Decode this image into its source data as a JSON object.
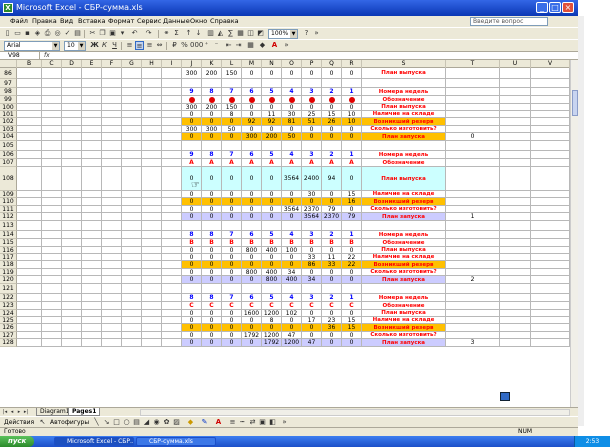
{
  "window": {
    "title": "Microsoft Excel - СБР-сумма.xls",
    "help_placeholder": "Введите вопрос"
  },
  "menu": [
    "Файл",
    "Правка",
    "Вид",
    "Вставка",
    "Формат",
    "Сервис",
    "Данные",
    "Окно",
    "Справка"
  ],
  "toolbar": {
    "zoom": "100%",
    "font_name": "Arial",
    "font_size": "10"
  },
  "formula": {
    "namebox": "V98",
    "fx": "fx"
  },
  "columns": [
    "B",
    "C",
    "D",
    "E",
    "F",
    "G",
    "H",
    "I",
    "J",
    "K",
    "L",
    "M",
    "N",
    "O",
    "P",
    "Q",
    "R",
    "S",
    "T",
    "U",
    "V"
  ],
  "rows": [
    {
      "num": "86",
      "h": 11,
      "style": "",
      "cells": {
        "J": "300",
        "K": "200",
        "L": "150",
        "M": "0",
        "N": "0",
        "O": "0",
        "P": "0",
        "Q": "0",
        "R": "0",
        "S": "План выпуска"
      },
      "color": "red"
    },
    {
      "num": "97",
      "h": 9,
      "style": "",
      "cells": {},
      "color": ""
    },
    {
      "num": "98",
      "h": 8,
      "style": "",
      "cells": {
        "J": "9",
        "K": "8",
        "L": "7",
        "M": "6",
        "N": "5",
        "O": "4",
        "P": "3",
        "Q": "2",
        "R": "1",
        "S": "Номера недель"
      },
      "color": "blue"
    },
    {
      "num": "99",
      "h": 8,
      "style": "",
      "cells": {
        "S": "Обозначение"
      },
      "dots": true,
      "color": "red"
    },
    {
      "num": "100",
      "h": 7,
      "style": "",
      "cells": {
        "J": "300",
        "K": "200",
        "L": "150",
        "M": "0",
        "N": "0",
        "O": "0",
        "P": "0",
        "Q": "0",
        "R": "0",
        "S": "План выпуска"
      },
      "color": "red"
    },
    {
      "num": "101",
      "h": 7,
      "style": "",
      "cells": {
        "J": "0",
        "K": "0",
        "L": "8",
        "M": "0",
        "N": "11",
        "O": "30",
        "P": "25",
        "Q": "15",
        "R": "10",
        "S": "Наличие на складе"
      },
      "color": "red"
    },
    {
      "num": "102",
      "h": 8,
      "style": "orange",
      "cells": {
        "J": "0",
        "K": "0",
        "L": "0",
        "M": "92",
        "N": "92",
        "O": "81",
        "P": "51",
        "Q": "26",
        "R": "10",
        "S": "Возникший резерв"
      },
      "color": "red"
    },
    {
      "num": "103",
      "h": 7,
      "style": "",
      "cells": {
        "J": "300",
        "K": "300",
        "L": "50",
        "M": "0",
        "N": "0",
        "O": "0",
        "P": "0",
        "Q": "0",
        "R": "0",
        "S": "Сколько изготовить?"
      },
      "color": "red"
    },
    {
      "num": "104",
      "h": 8,
      "style": "orange",
      "cells": {
        "J": "0",
        "K": "0",
        "L": "0",
        "M": "300",
        "N": "200",
        "O": "50",
        "P": "0",
        "Q": "0",
        "R": "0",
        "S": "План запуска",
        "T": "0"
      },
      "color": "red"
    },
    {
      "num": "105",
      "h": 10,
      "style": "",
      "cells": {},
      "color": ""
    },
    {
      "num": "106",
      "h": 8,
      "style": "",
      "cells": {
        "J": "9",
        "K": "8",
        "L": "7",
        "M": "6",
        "N": "5",
        "O": "4",
        "P": "3",
        "Q": "2",
        "R": "1",
        "S": "Номера недель"
      },
      "color": "blue"
    },
    {
      "num": "107",
      "h": 8,
      "style": "",
      "cells": {
        "J": "А",
        "K": "А",
        "L": "А",
        "M": "А",
        "N": "А",
        "O": "А",
        "P": "А",
        "Q": "А",
        "R": "А",
        "S": "Обозначение"
      },
      "color": "red"
    },
    {
      "num": "108",
      "h": 24,
      "style": "cyan",
      "cells": {
        "J": "0",
        "K": "0",
        "L": "0",
        "M": "0",
        "N": "0",
        "O": "3564",
        "P": "2400",
        "Q": "94",
        "R": "0",
        "S": "План выпуска"
      },
      "color": "red"
    },
    {
      "num": "109",
      "h": 7,
      "style": "",
      "cells": {
        "J": "0",
        "K": "0",
        "L": "0",
        "M": "0",
        "N": "0",
        "O": "0",
        "P": "30",
        "Q": "0",
        "R": "15",
        "S": "Наличие на складе"
      },
      "color": "red"
    },
    {
      "num": "110",
      "h": 8,
      "style": "orange",
      "cells": {
        "J": "0",
        "K": "0",
        "L": "0",
        "M": "0",
        "N": "0",
        "O": "0",
        "P": "0",
        "Q": "0",
        "R": "16",
        "S": "Возникший резерв"
      },
      "color": "red"
    },
    {
      "num": "111",
      "h": 7,
      "style": "",
      "cells": {
        "J": "0",
        "K": "0",
        "L": "0",
        "M": "0",
        "N": "0",
        "O": "3564",
        "P": "2370",
        "Q": "79",
        "R": "0",
        "S": "Сколько изготовить?"
      },
      "color": "red"
    },
    {
      "num": "112",
      "h": 8,
      "style": "lilac",
      "cells": {
        "J": "0",
        "K": "0",
        "L": "0",
        "M": "0",
        "N": "0",
        "O": "0",
        "P": "3564",
        "Q": "2370",
        "R": "79",
        "S": "План запуска",
        "T": "1"
      },
      "color": "red"
    },
    {
      "num": "113",
      "h": 10,
      "style": "",
      "cells": {},
      "color": ""
    },
    {
      "num": "114",
      "h": 8,
      "style": "",
      "cells": {
        "J": "8",
        "K": "8",
        "L": "7",
        "M": "6",
        "N": "5",
        "O": "4",
        "P": "3",
        "Q": "2",
        "R": "1",
        "S": "Номера недель"
      },
      "color": "blue"
    },
    {
      "num": "115",
      "h": 8,
      "style": "",
      "cells": {
        "J": "В",
        "K": "В",
        "L": "В",
        "M": "В",
        "N": "В",
        "O": "В",
        "P": "В",
        "Q": "В",
        "R": "В",
        "S": "Обозначение"
      },
      "color": "red"
    },
    {
      "num": "116",
      "h": 7,
      "style": "",
      "cells": {
        "J": "0",
        "K": "0",
        "L": "0",
        "M": "800",
        "N": "400",
        "O": "100",
        "P": "0",
        "Q": "0",
        "R": "0",
        "S": "План выпуска"
      },
      "color": "red"
    },
    {
      "num": "117",
      "h": 7,
      "style": "",
      "cells": {
        "J": "0",
        "K": "0",
        "L": "0",
        "M": "0",
        "N": "0",
        "O": "0",
        "P": "33",
        "Q": "11",
        "R": "22",
        "S": "Наличие на складе"
      },
      "color": "red"
    },
    {
      "num": "118",
      "h": 8,
      "style": "orange",
      "cells": {
        "J": "0",
        "K": "0",
        "L": "0",
        "M": "0",
        "N": "0",
        "O": "0",
        "P": "86",
        "Q": "33",
        "R": "22",
        "S": "Возникший резерв"
      },
      "color": "red"
    },
    {
      "num": "119",
      "h": 7,
      "style": "",
      "cells": {
        "J": "0",
        "K": "0",
        "L": "0",
        "M": "800",
        "N": "400",
        "O": "34",
        "P": "0",
        "Q": "0",
        "R": "0",
        "S": "Сколько изготовить?"
      },
      "color": "red"
    },
    {
      "num": "120",
      "h": 8,
      "style": "lilac",
      "cells": {
        "J": "0",
        "K": "0",
        "L": "0",
        "M": "0",
        "N": "800",
        "O": "400",
        "P": "34",
        "Q": "0",
        "R": "0",
        "S": "План запуска",
        "T": "2"
      },
      "color": "red"
    },
    {
      "num": "121",
      "h": 10,
      "style": "",
      "cells": {},
      "color": ""
    },
    {
      "num": "122",
      "h": 8,
      "style": "",
      "cells": {
        "J": "8",
        "K": "8",
        "L": "7",
        "M": "6",
        "N": "5",
        "O": "4",
        "P": "3",
        "Q": "2",
        "R": "1",
        "S": "Номера недель"
      },
      "color": "blue"
    },
    {
      "num": "123",
      "h": 8,
      "style": "",
      "cells": {
        "J": "С",
        "K": "С",
        "L": "С",
        "M": "С",
        "N": "С",
        "O": "С",
        "P": "С",
        "Q": "С",
        "R": "С",
        "S": "Обозначение"
      },
      "color": "red"
    },
    {
      "num": "124",
      "h": 7,
      "style": "",
      "cells": {
        "J": "0",
        "K": "0",
        "L": "0",
        "M": "1600",
        "N": "1200",
        "O": "102",
        "P": "0",
        "Q": "0",
        "R": "0",
        "S": "План выпуска"
      },
      "color": "red"
    },
    {
      "num": "125",
      "h": 7,
      "style": "",
      "cells": {
        "J": "0",
        "K": "0",
        "L": "0",
        "M": "0",
        "N": "8",
        "O": "0",
        "P": "17",
        "Q": "23",
        "R": "15",
        "S": "Наличие на складе"
      },
      "color": "red"
    },
    {
      "num": "126",
      "h": 8,
      "style": "orange",
      "cells": {
        "J": "0",
        "K": "0",
        "L": "0",
        "M": "0",
        "N": "0",
        "O": "0",
        "P": "0",
        "Q": "36",
        "R": "15",
        "S": "Возникший резерв"
      },
      "color": "red"
    },
    {
      "num": "127",
      "h": 7,
      "style": "",
      "cells": {
        "J": "0",
        "K": "0",
        "L": "0",
        "M": "1792",
        "N": "1200",
        "O": "47",
        "P": "0",
        "Q": "0",
        "R": "0",
        "S": "Сколько изготовить?"
      },
      "color": "red"
    },
    {
      "num": "128",
      "h": 8,
      "style": "lilac",
      "cells": {
        "J": "0",
        "K": "0",
        "L": "0",
        "M": "0",
        "N": "1792",
        "O": "1200",
        "P": "47",
        "Q": "0",
        "R": "0",
        "S": "План запуска",
        "T": "3"
      },
      "color": "red"
    }
  ],
  "sheet_tabs": [
    "Diagram1",
    "Pages1"
  ],
  "drawing": {
    "actions": "Действия",
    "autoshapes": "Автофигуры"
  },
  "status": {
    "ready": "Готово",
    "num": "NUM"
  },
  "taskbar": {
    "start": "пуск",
    "items": [
      "Microsoft Excel - СБР...",
      "СБР-сумма.xls"
    ],
    "tray": "2:53"
  }
}
